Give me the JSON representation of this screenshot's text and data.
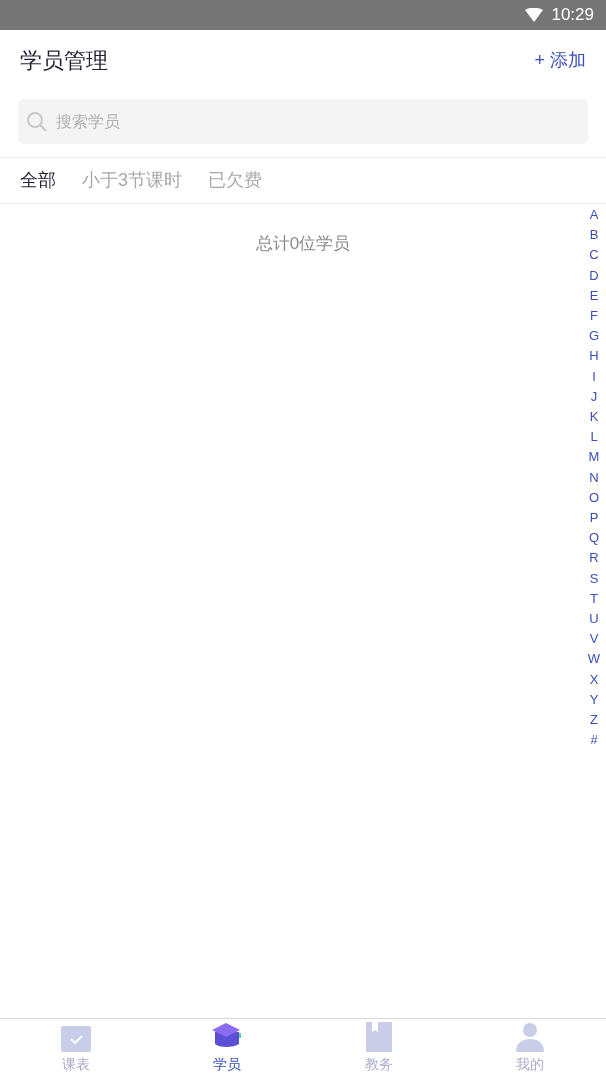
{
  "status_bar": {
    "time": "10:29"
  },
  "header": {
    "title": "学员管理",
    "action": "+ 添加"
  },
  "search": {
    "placeholder": "搜索学员"
  },
  "filters": [
    {
      "label": "全部",
      "selected": true
    },
    {
      "label": "小于3节课时",
      "selected": false
    },
    {
      "label": "已欠费",
      "selected": false
    }
  ],
  "summary": "总计0位学员",
  "index_letters": [
    "A",
    "B",
    "C",
    "D",
    "E",
    "F",
    "G",
    "H",
    "I",
    "J",
    "K",
    "L",
    "M",
    "N",
    "O",
    "P",
    "Q",
    "R",
    "S",
    "T",
    "U",
    "V",
    "W",
    "X",
    "Y",
    "Z",
    "#"
  ],
  "bottom_nav": [
    {
      "label": "课表",
      "selected": false
    },
    {
      "label": "学员",
      "selected": true
    },
    {
      "label": "教务",
      "selected": false
    },
    {
      "label": "我的",
      "selected": false
    }
  ]
}
